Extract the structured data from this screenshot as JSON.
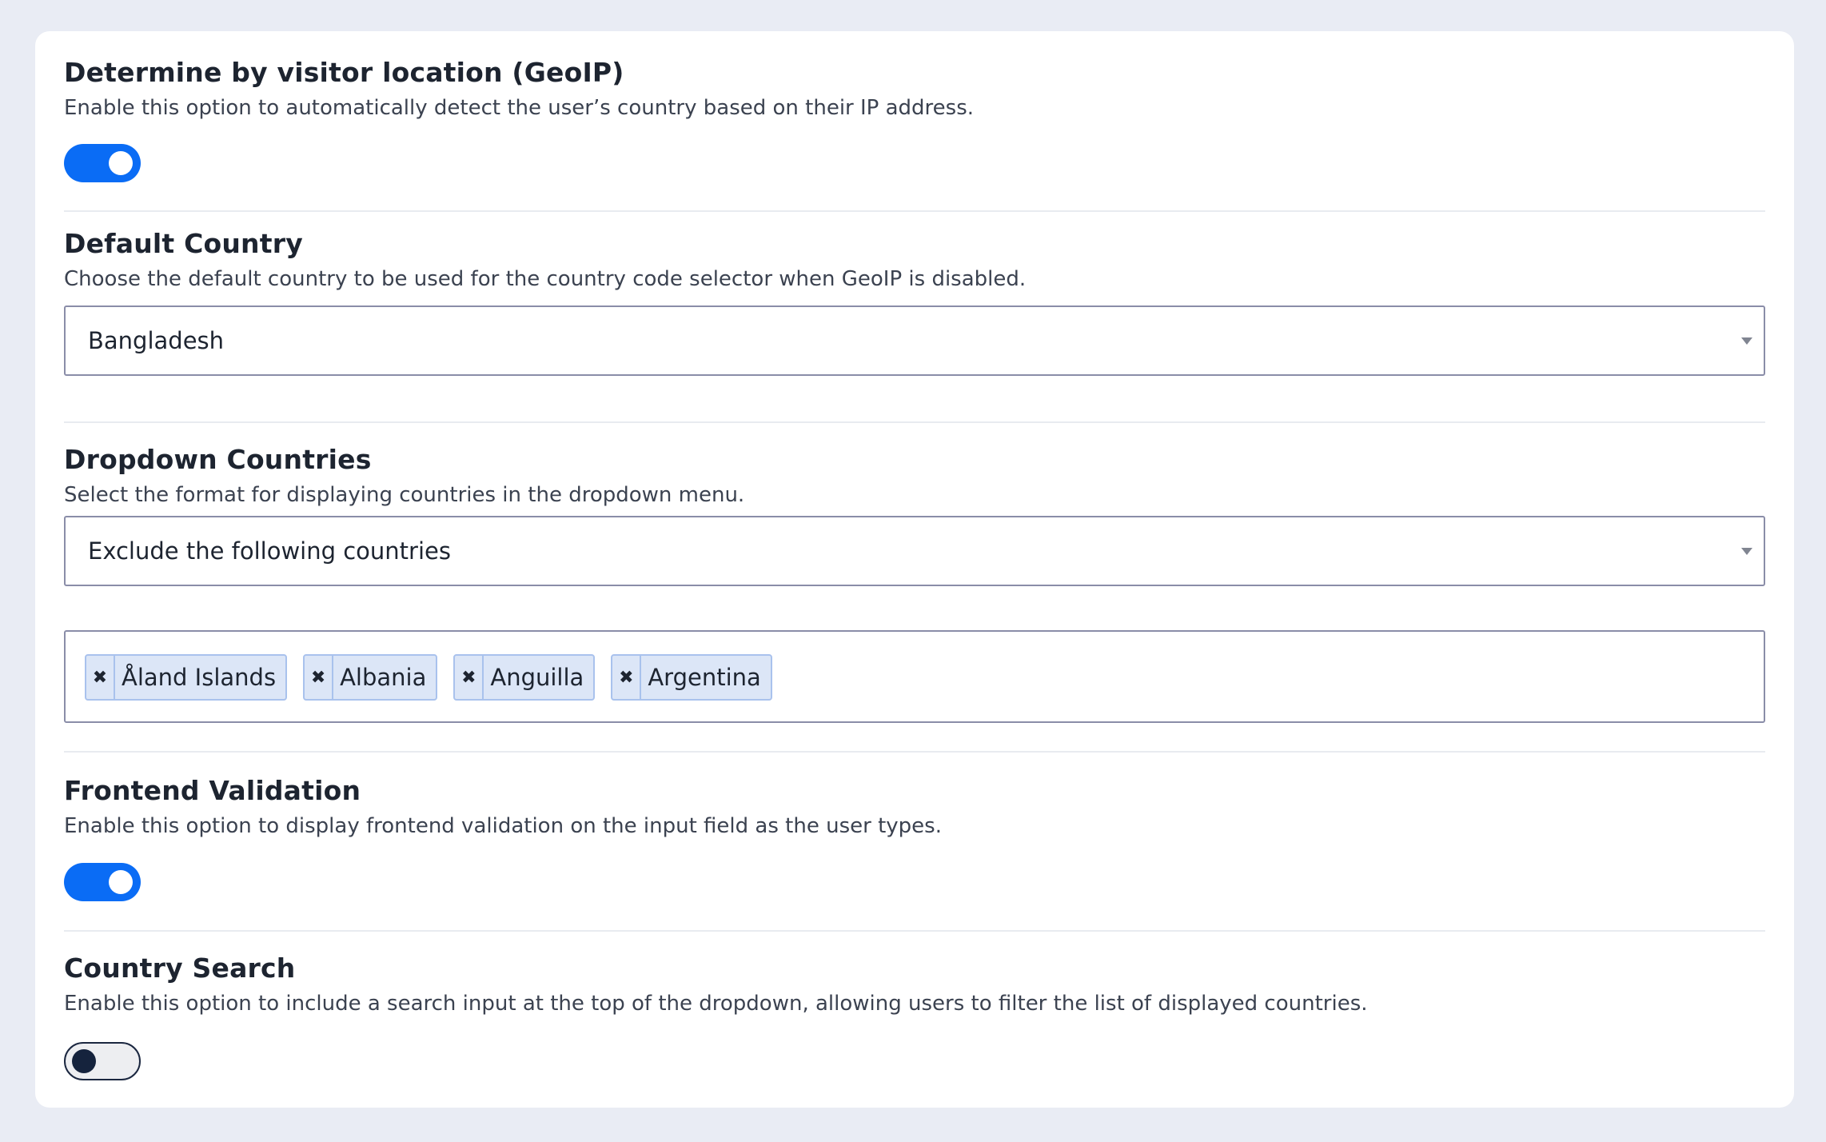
{
  "geoip": {
    "title": "Determine by visitor location (GeoIP)",
    "description": "Enable this option to automatically detect the user’s country based on their IP address.",
    "enabled": true
  },
  "default_country": {
    "title": "Default Country",
    "description": "Choose the default country to be used for the country code selector when GeoIP is disabled.",
    "selected": "Bangladesh"
  },
  "dropdown_countries": {
    "title": "Dropdown Countries",
    "description": "Select the format for displaying countries in the dropdown menu.",
    "selected": "Exclude the following countries",
    "tags": [
      {
        "remove": "✖",
        "label": "Åland Islands"
      },
      {
        "remove": "✖",
        "label": "Albania"
      },
      {
        "remove": "✖",
        "label": "Anguilla"
      },
      {
        "remove": "✖",
        "label": "Argentina"
      }
    ]
  },
  "frontend_validation": {
    "title": "Frontend Validation",
    "description": "Enable this option to display frontend validation on the input field as the user types.",
    "enabled": true
  },
  "country_search": {
    "title": "Country Search",
    "description": "Enable this option to include a search input at the top of the dropdown, allowing users to filter the list of displayed countries.",
    "enabled": false
  },
  "colors": {
    "accent": "#0a6cf5",
    "tag_bg": "#dce6f7",
    "tag_border": "#a9c2ed"
  },
  "icons": {
    "tag_remove": "close-icon",
    "select_caret": "chevron-down-icon"
  }
}
